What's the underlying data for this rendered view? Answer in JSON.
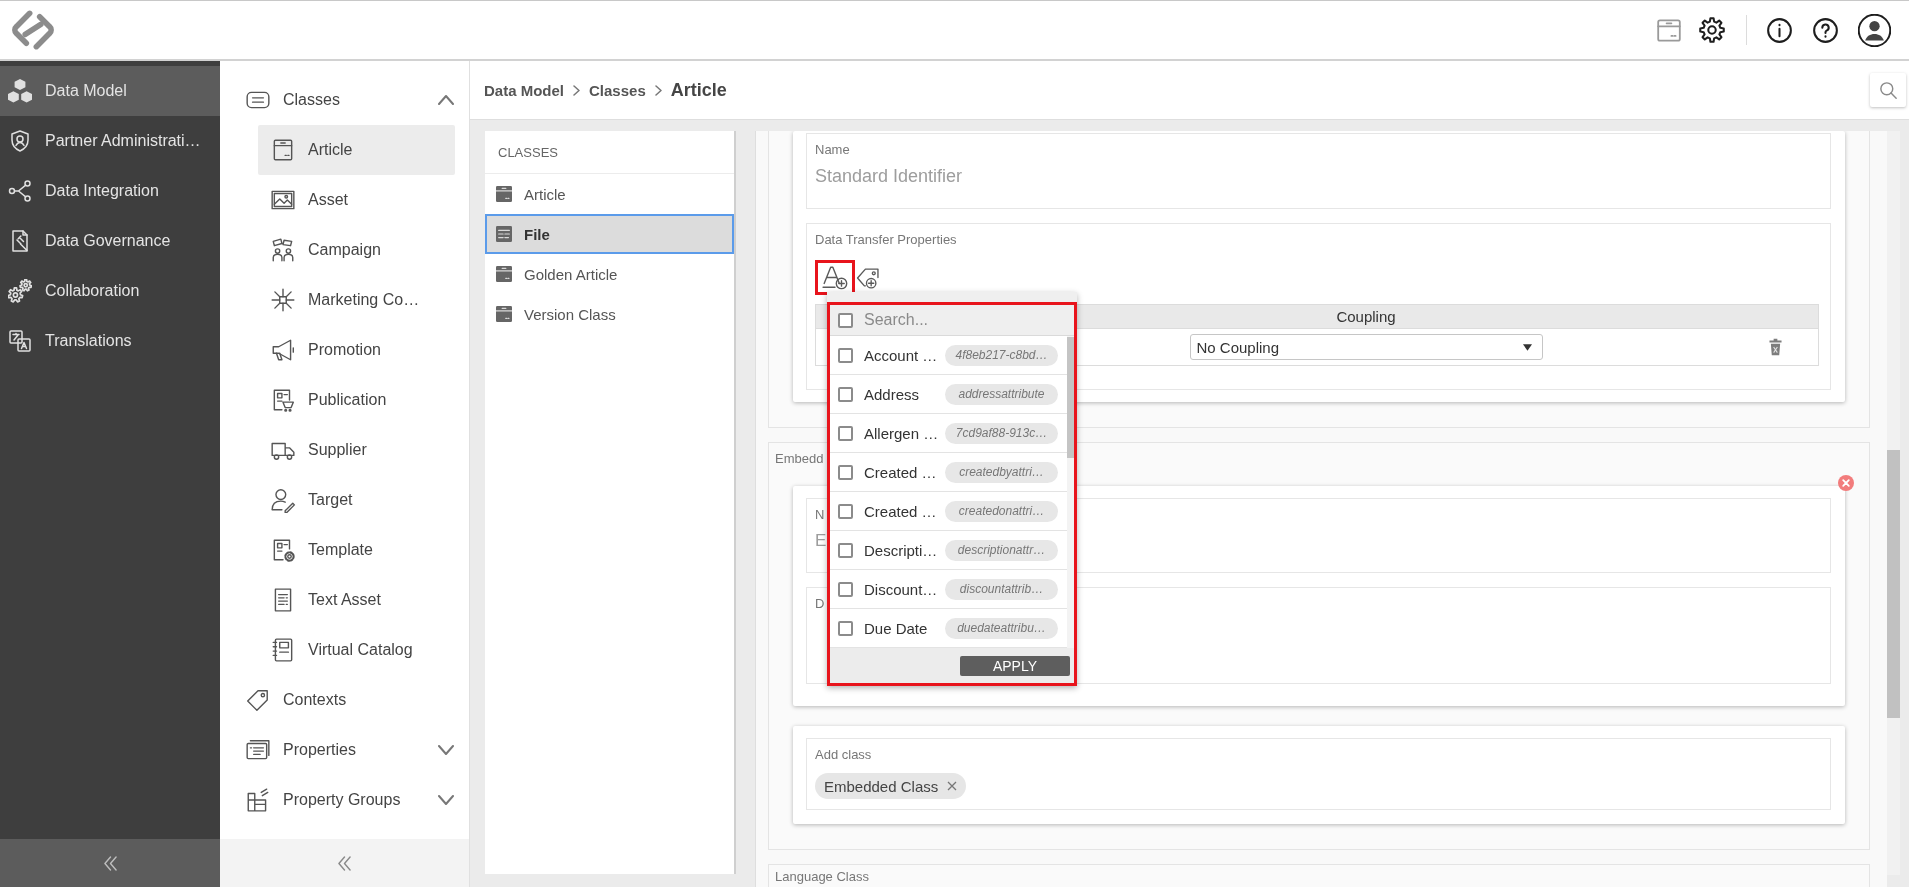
{
  "main_nav": {
    "items": [
      {
        "label": "Data Model",
        "selected": true
      },
      {
        "label": "Partner Administrati…",
        "selected": false
      },
      {
        "label": "Data Integration",
        "selected": false
      },
      {
        "label": "Data Governance",
        "selected": false
      },
      {
        "label": "Collaboration",
        "selected": false
      },
      {
        "label": "Translations",
        "selected": false
      }
    ]
  },
  "sub_nav": {
    "items": [
      {
        "label": "Classes",
        "kind": "group",
        "selected": false,
        "expanded": true,
        "children": [
          {
            "label": "Article",
            "selected": true
          },
          {
            "label": "Asset",
            "selected": false
          },
          {
            "label": "Campaign",
            "selected": false
          },
          {
            "label": "Marketing Co…",
            "selected": false
          },
          {
            "label": "Promotion",
            "selected": false
          },
          {
            "label": "Publication",
            "selected": false
          },
          {
            "label": "Supplier",
            "selected": false
          },
          {
            "label": "Target",
            "selected": false
          },
          {
            "label": "Template",
            "selected": false
          },
          {
            "label": "Text Asset",
            "selected": false
          },
          {
            "label": "Virtual Catalog",
            "selected": false
          }
        ]
      },
      {
        "label": "Contexts",
        "kind": "link",
        "selected": false
      },
      {
        "label": "Properties",
        "kind": "group",
        "selected": false,
        "expanded": false
      },
      {
        "label": "Property Groups",
        "kind": "group",
        "selected": false,
        "expanded": false
      }
    ]
  },
  "breadcrumb": [
    {
      "label": "Data Model",
      "current": false
    },
    {
      "label": "Classes",
      "current": false
    },
    {
      "label": "Article",
      "current": true
    }
  ],
  "classes_panel": {
    "title": "CLASSES",
    "items": [
      {
        "label": "Article",
        "selected": false
      },
      {
        "label": "File",
        "selected": true
      },
      {
        "label": "Golden Article",
        "selected": false
      },
      {
        "label": "Version Class",
        "selected": false
      }
    ]
  },
  "identifier_card": {
    "name_field": {
      "label": "Name",
      "value": "Standard Identifier"
    },
    "data_transfer": {
      "label": "Data Transfer Properties",
      "table": {
        "columns": [
          {
            "label": "Coupling"
          }
        ],
        "rows": [
          {
            "coupling": "No Coupling"
          }
        ]
      }
    }
  },
  "attribute_picker": {
    "select_all": {
      "checked": false
    },
    "search": {
      "placeholder": "Search..."
    },
    "options": [
      {
        "label": "Account …",
        "tag": "4f8eb217-c8bd…",
        "checked": false
      },
      {
        "label": "Address",
        "tag": "addressattribute",
        "checked": false
      },
      {
        "label": "Allergen …",
        "tag": "7cd9af88-913c…",
        "checked": false
      },
      {
        "label": "Created …",
        "tag": "createdbyattri…",
        "checked": false
      },
      {
        "label": "Created …",
        "tag": "createdonattri…",
        "checked": false
      },
      {
        "label": "Descripti…",
        "tag": "descriptionattr…",
        "checked": false
      },
      {
        "label": "Discount…",
        "tag": "discountattrib…",
        "checked": false
      },
      {
        "label": "Due Date",
        "tag": "duedateattribu…",
        "checked": false
      }
    ],
    "apply": "APPLY"
  },
  "embedded_section": {
    "label": "Embedd",
    "card": {
      "fields": [
        {
          "label": "N",
          "value": "E"
        },
        {
          "label": "D"
        }
      ]
    },
    "add_class": {
      "label": "Add class",
      "tags": [
        "Embedded Class"
      ]
    }
  },
  "language_section": {
    "label": "Language Class"
  }
}
